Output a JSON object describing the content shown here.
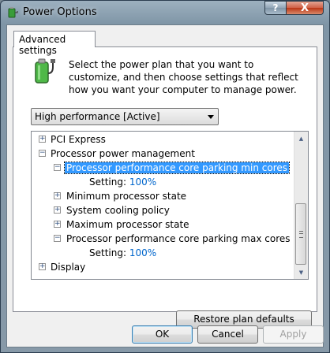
{
  "window": {
    "title": "Power Options",
    "help_label": "?",
    "close_label": "X"
  },
  "tab": {
    "label": "Advanced settings"
  },
  "description": "Select the power plan that you want to customize, and then choose settings that reflect how you want your computer to manage power.",
  "plan_select": {
    "value": "High performance [Active]"
  },
  "tree": {
    "items": [
      {
        "label": "PCI Express",
        "expander": "+"
      },
      {
        "label": "Processor power management",
        "expander": "−"
      },
      {
        "label": "Processor performance core parking min cores",
        "expander": "−"
      },
      {
        "label": "Setting:",
        "value": "100%"
      },
      {
        "label": "Minimum processor state",
        "expander": "+"
      },
      {
        "label": "System cooling policy",
        "expander": "+"
      },
      {
        "label": "Maximum processor state",
        "expander": "+"
      },
      {
        "label": "Processor performance core parking max cores",
        "expander": "−"
      },
      {
        "label": "Setting:",
        "value": "100%"
      },
      {
        "label": "Display",
        "expander": "+"
      }
    ]
  },
  "buttons": {
    "restore": "Restore plan defaults",
    "ok": "OK",
    "cancel": "Cancel",
    "apply": "Apply"
  },
  "colors": {
    "selection": "#3399ff",
    "setting_value": "#0066cc"
  },
  "icons": {
    "app": "power-options-icon",
    "plan": "battery-plug-icon"
  }
}
